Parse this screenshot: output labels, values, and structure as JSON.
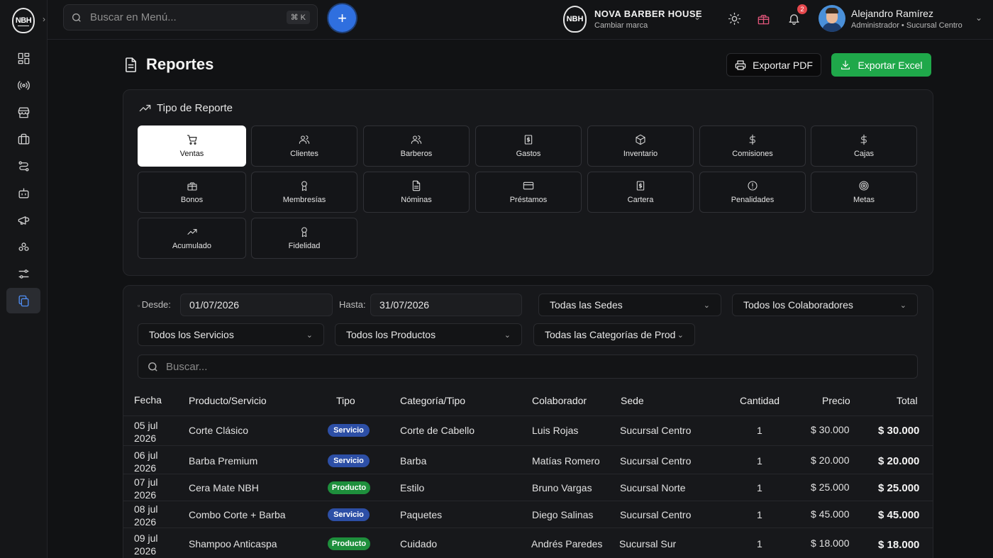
{
  "app": {
    "logo_text": "NBH"
  },
  "topbar": {
    "search_placeholder": "Buscar en Menú...",
    "shortcut": "⌘ K",
    "brand_logo": "NBH",
    "brand_name": "NOVA BARBER HOUSE",
    "brand_sub": "Cambiar marca",
    "notifications_count": "2",
    "user_name": "Alejandro Ramírez",
    "user_role": "Administrador  •  Sucursal Centro"
  },
  "page": {
    "title": "Reportes",
    "export_pdf": "Exportar PDF",
    "export_excel": "Exportar Excel"
  },
  "report_type": {
    "header": "Tipo de Reporte",
    "tiles": [
      {
        "label": "Ventas",
        "icon": "cart-icon",
        "active": true
      },
      {
        "label": "Clientes",
        "icon": "users-icon"
      },
      {
        "label": "Barberos",
        "icon": "users-icon"
      },
      {
        "label": "Gastos",
        "icon": "receipt-icon"
      },
      {
        "label": "Inventario",
        "icon": "box-icon"
      },
      {
        "label": "Comisiones",
        "icon": "dollar-icon"
      },
      {
        "label": "Cajas",
        "icon": "dollar-icon"
      },
      {
        "label": "Bonos",
        "icon": "gift-icon"
      },
      {
        "label": "Membresías",
        "icon": "award-icon"
      },
      {
        "label": "Nóminas",
        "icon": "file-icon"
      },
      {
        "label": "Préstamos",
        "icon": "card-icon"
      },
      {
        "label": "Cartera",
        "icon": "receipt-icon"
      },
      {
        "label": "Penalidades",
        "icon": "alert-icon"
      },
      {
        "label": "Metas",
        "icon": "target-icon"
      },
      {
        "label": "Acumulado",
        "icon": "trend-icon"
      },
      {
        "label": "Fidelidad",
        "icon": "award-icon"
      }
    ]
  },
  "filters": {
    "desde_label": "Desde:",
    "desde_value": "01/07/2026",
    "hasta_label": "Hasta:",
    "hasta_value": "31/07/2026",
    "sedes": "Todas las Sedes",
    "colaboradores": "Todos los Colaboradores",
    "servicios": "Todos los Servicios",
    "productos": "Todos los Productos",
    "categorias": "Todas las Categorías de Prod",
    "search_placeholder": "Buscar..."
  },
  "table": {
    "headers": [
      "Fecha",
      "Producto/Servicio",
      "Tipo",
      "Categoría/Tipo",
      "Colaborador",
      "Sede",
      "Cantidad",
      "Precio",
      "Total"
    ],
    "rows": [
      {
        "d1": "05 jul",
        "d2": "2026",
        "item": "Corte Clásico",
        "tipo": "Servicio",
        "cat": "Corte de Cabello",
        "colab": "Luis Rojas",
        "sede": "Sucursal Centro",
        "qty": "1",
        "price": "$ 30.000",
        "total": "$ 30.000"
      },
      {
        "d1": "06 jul",
        "d2": "2026",
        "item": "Barba Premium",
        "tipo": "Servicio",
        "cat": "Barba",
        "colab": "Matías Romero",
        "sede": "Sucursal Centro",
        "qty": "1",
        "price": "$ 20.000",
        "total": "$ 20.000"
      },
      {
        "d1": "07 jul",
        "d2": "2026",
        "item": "Cera Mate NBH",
        "tipo": "Producto",
        "cat": "Estilo",
        "colab": "Bruno Vargas",
        "sede": "Sucursal Norte",
        "qty": "1",
        "price": "$ 25.000",
        "total": "$ 25.000"
      },
      {
        "d1": "08 jul",
        "d2": "2026",
        "item": "Combo Corte + Barba",
        "tipo": "Servicio",
        "cat": "Paquetes",
        "colab": "Diego Salinas",
        "sede": "Sucursal Centro",
        "qty": "1",
        "price": "$ 45.000",
        "total": "$ 45.000"
      },
      {
        "d1": "09 jul",
        "d2": "2026",
        "item": "Shampoo Anticaspa",
        "tipo": "Producto",
        "cat": "Cuidado",
        "colab": "Andrés Paredes",
        "sede": "Sucursal Sur",
        "qty": "1",
        "price": "$ 18.000",
        "total": "$ 18.000"
      }
    ]
  }
}
